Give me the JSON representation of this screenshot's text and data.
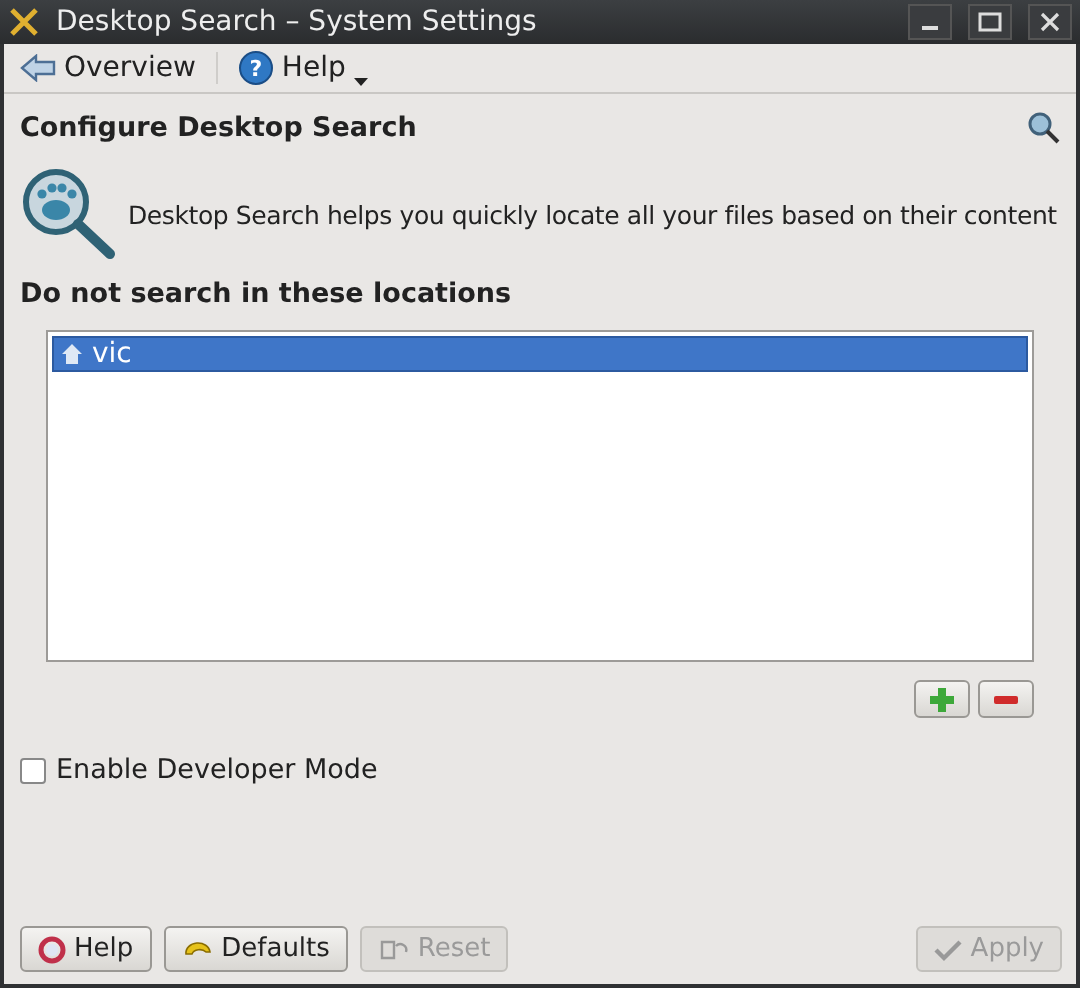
{
  "window": {
    "title": "Desktop Search – System Settings"
  },
  "toolbar": [
    {
      "label": "Overview",
      "kind": "back"
    },
    {
      "label": "Help",
      "kind": "help-menu",
      "icon": "?"
    }
  ],
  "page": {
    "title": "Configure Desktop Search",
    "description": "Desktop Search helps you quickly locate all your files based on their content"
  },
  "excluded": {
    "heading": "Do not search in these locations",
    "items": [
      {
        "label": "vic",
        "selected": true
      }
    ]
  },
  "list_buttons": [
    {
      "kind": "add",
      "disabled": false
    },
    {
      "kind": "remove",
      "disabled": false
    }
  ],
  "developer_mode": {
    "label": "Enable Developer Mode",
    "checked": false
  },
  "buttons": [
    {
      "label": "Help",
      "kind": "help",
      "disabled": false
    },
    {
      "label": "Defaults",
      "kind": "defaults",
      "disabled": false
    },
    {
      "label": "Reset",
      "kind": "reset",
      "disabled": true
    },
    {
      "label": "Apply",
      "kind": "apply",
      "disabled": true
    }
  ]
}
